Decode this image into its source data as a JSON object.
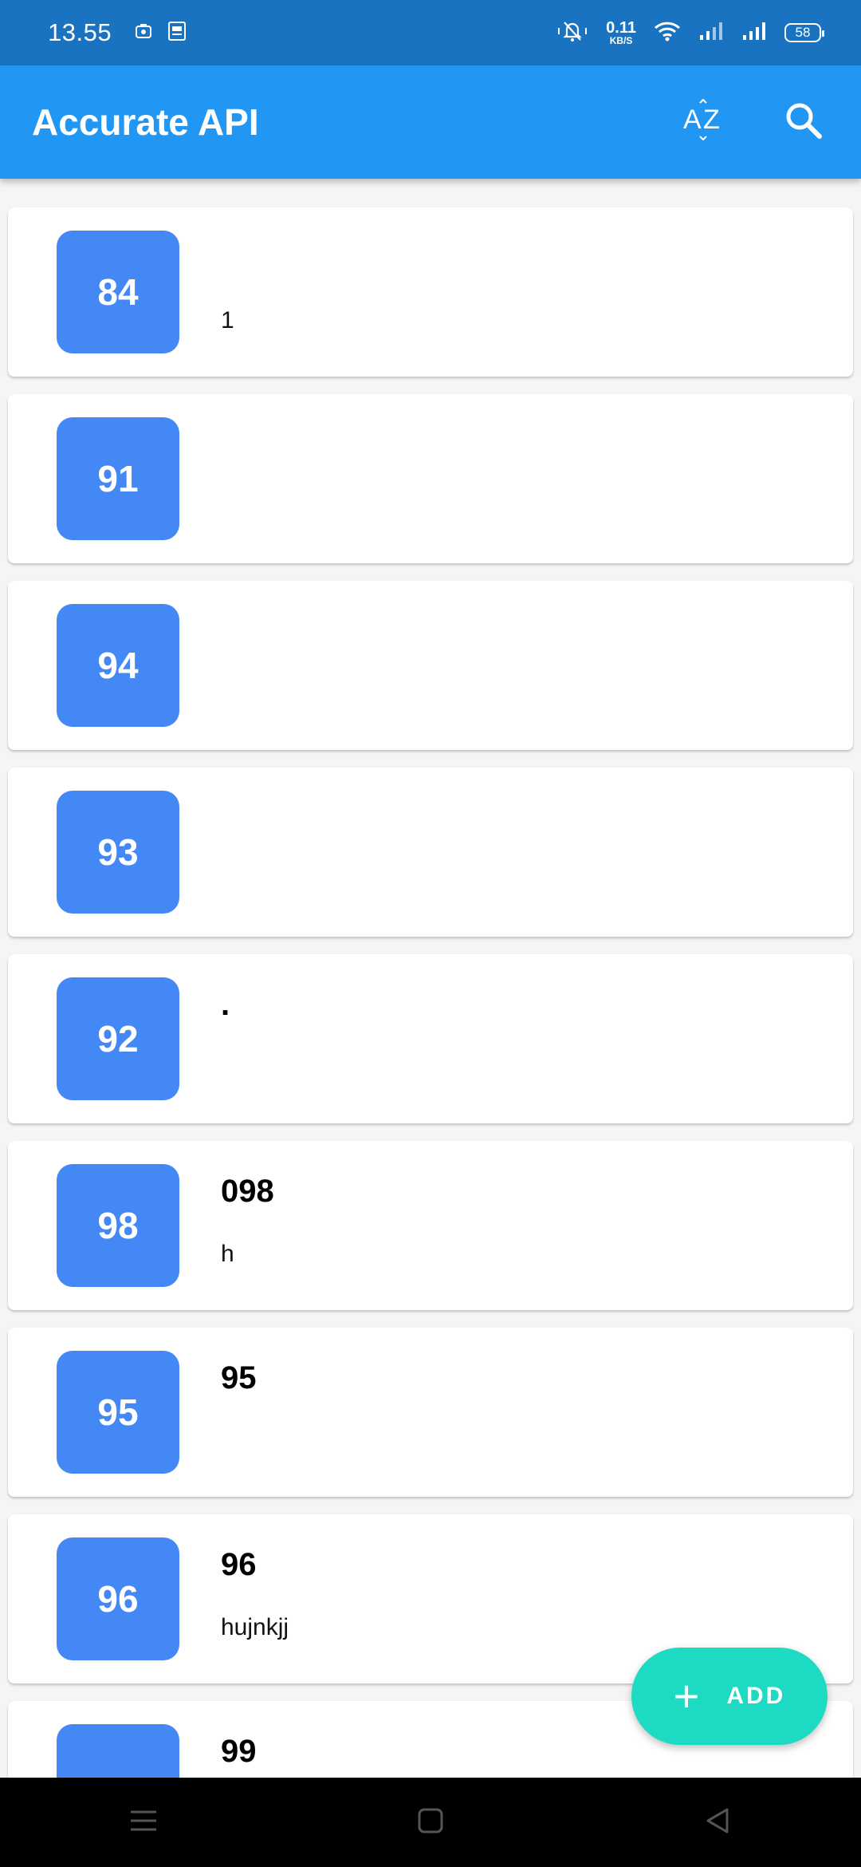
{
  "status_bar": {
    "time": "13.55",
    "net_speed_value": "0.11",
    "net_speed_unit": "KB/S",
    "battery": "58"
  },
  "app_bar": {
    "title": "Accurate API",
    "sort_icon": "sort-alpha-icon",
    "search_icon": "search-icon"
  },
  "items": [
    {
      "id": "84",
      "title": "",
      "subtitle": "1"
    },
    {
      "id": "91",
      "title": "",
      "subtitle": ""
    },
    {
      "id": "94",
      "title": "",
      "subtitle": ""
    },
    {
      "id": "93",
      "title": "",
      "subtitle": ""
    },
    {
      "id": "92",
      "title": ".",
      "subtitle": ""
    },
    {
      "id": "98",
      "title": "098",
      "subtitle": "h"
    },
    {
      "id": "95",
      "title": "95",
      "subtitle": ""
    },
    {
      "id": "96",
      "title": "96",
      "subtitle": "hujnkjj"
    },
    {
      "id": "",
      "title": "99",
      "subtitle": ""
    }
  ],
  "fab": {
    "label": "ADD",
    "icon": "plus-icon"
  },
  "colors": {
    "status_bar": "#1a73c0",
    "app_bar": "#2196f3",
    "badge": "#4488f6",
    "fab": "#1ddbc3"
  }
}
